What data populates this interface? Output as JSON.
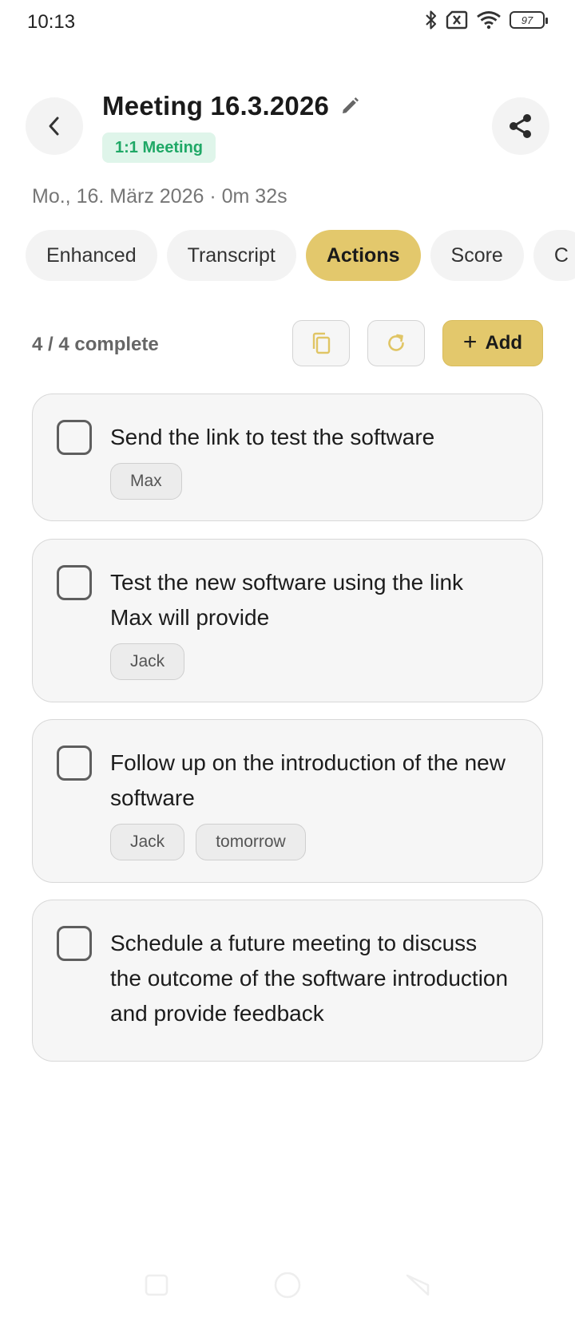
{
  "status_bar": {
    "time": "10:13",
    "battery": "97",
    "icons": [
      "bluetooth-icon",
      "sim-off-icon",
      "wifi-icon",
      "battery-icon"
    ]
  },
  "header": {
    "title": "Meeting 16.3.2026",
    "meeting_type": "1:1 Meeting",
    "date": "Mo., 16. März 2026",
    "duration": "· 0m 32s"
  },
  "tabs": [
    {
      "label": "Enhanced",
      "active": false
    },
    {
      "label": "Transcript",
      "active": false
    },
    {
      "label": "Actions",
      "active": true
    },
    {
      "label": "Score",
      "active": false
    },
    {
      "label": "C",
      "active": false
    }
  ],
  "toolbar": {
    "complete_count": "4 / 4 complete",
    "add_label": "Add"
  },
  "actions": [
    {
      "text": "Send the link to test the software",
      "tags": [
        "Max"
      ]
    },
    {
      "text": "Test the new software using the link Max will provide",
      "tags": [
        "Jack"
      ]
    },
    {
      "text": "Follow up on the introduction of the new software",
      "tags": [
        "Jack",
        "tomorrow"
      ]
    },
    {
      "text": "Schedule a future meeting to discuss the outcome of the software introduction and provide feedback",
      "tags": []
    }
  ],
  "colors": {
    "accent": "#e3c86c",
    "badge_bg": "#dff5ea",
    "badge_text": "#1fa866",
    "card_bg": "#f6f6f6"
  }
}
